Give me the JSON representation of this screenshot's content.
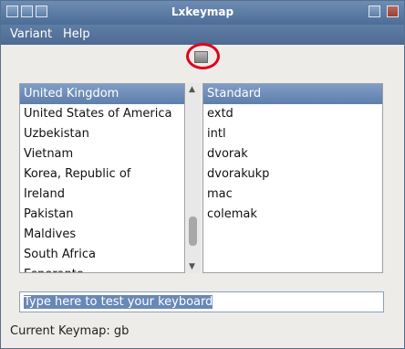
{
  "window": {
    "title": "Lxkeymap"
  },
  "menu": {
    "variant": "Variant",
    "help": "Help"
  },
  "toolbar": {
    "icon": "keyboard-icon"
  },
  "countries": [
    "United Kingdom",
    "United States of America",
    "Uzbekistan",
    "Vietnam",
    "Korea, Republic of",
    "Ireland",
    "Pakistan",
    "Maldives",
    "South Africa",
    "Esperanto"
  ],
  "variants": [
    "Standard",
    "extd",
    "intl",
    "dvorak",
    "dvorakukp",
    "mac",
    "colemak"
  ],
  "test": {
    "placeholder": "Type here to test your keyboard"
  },
  "status": {
    "current_keymap": "Current Keymap: gb"
  },
  "colors": {
    "accent": "#5e7fab",
    "annotation": "#e0001a"
  }
}
